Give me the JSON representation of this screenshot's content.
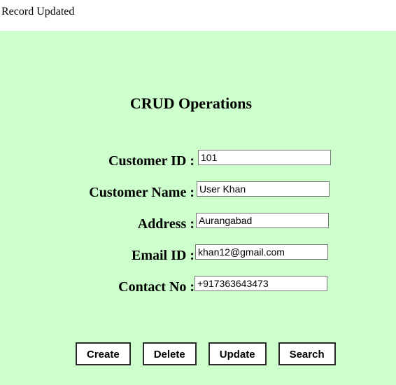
{
  "status": {
    "message": "Record Updated"
  },
  "page": {
    "title": "CRUD Operations",
    "panel_color": "#ccffcc",
    "background_color": "#ffffff"
  },
  "form": {
    "fields": [
      {
        "label": "Customer ID :",
        "value": "101",
        "name": "customer-id"
      },
      {
        "label": "Customer Name  :",
        "value": "User Khan",
        "name": "customer-name"
      },
      {
        "label": "Address  :",
        "value": "Aurangabad",
        "name": "address"
      },
      {
        "label": "Email ID  :",
        "value": "khan12@gmail.com",
        "name": "email-id"
      },
      {
        "label": "Contact No :",
        "value": "+917363643473",
        "name": "contact-no"
      }
    ]
  },
  "buttons": [
    {
      "label": "Create",
      "name": "create"
    },
    {
      "label": "Delete",
      "name": "delete"
    },
    {
      "label": "Update",
      "name": "update"
    },
    {
      "label": "Search",
      "name": "search"
    }
  ]
}
